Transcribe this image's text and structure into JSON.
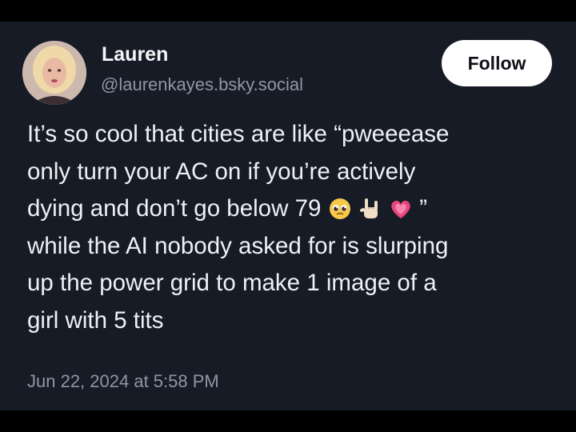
{
  "post": {
    "author": {
      "display_name": "Lauren",
      "handle": "@laurenkayes.bsky.social",
      "avatar": "profile-photo"
    },
    "follow_label": "Follow",
    "text_lines": {
      "line1": "It’s so cool that cities are like “pweeease",
      "line2": "only turn your AC on if you’re actively",
      "line3_start": "dying and don’t go below 79",
      "line3_end": "”",
      "line4": "while the AI nobody asked for is slurping",
      "line5": "up the power grid to make 1 image of a",
      "line6": "girl with 5 tits"
    },
    "emojis": [
      "pleading-face-emoji",
      "sign-of-the-horns-emoji",
      "growing-heart-emoji"
    ],
    "timestamp": "Jun 22, 2024 at 5:58 PM"
  },
  "colors": {
    "background": "#161b25",
    "text": "#eef1f5",
    "muted": "#8d97a6",
    "button": "#ffffff"
  }
}
